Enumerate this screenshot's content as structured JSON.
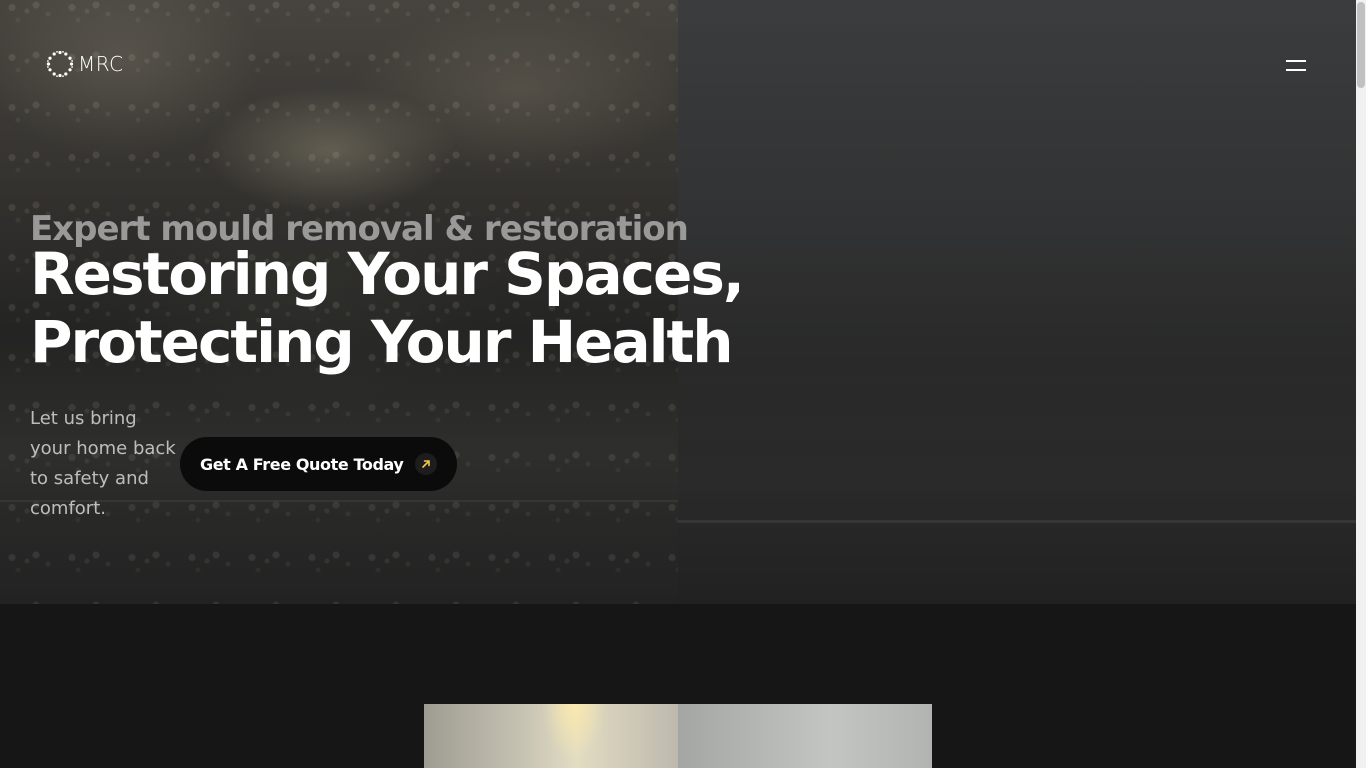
{
  "header": {
    "logo_text": "MRC",
    "logo_icon": "dotted-circle-icon",
    "menu_icon": "hamburger-menu-icon"
  },
  "hero": {
    "eyebrow": "Expert mould removal & restoration",
    "headline_line1": "Restoring Your Spaces,",
    "headline_line2": "Protecting Your Health",
    "subtext": "Let us bring your home back to safety and comfort.",
    "cta_label": "Get A Free Quote Today",
    "cta_icon": "arrow-up-right-icon"
  },
  "colors": {
    "page_background": "#161616",
    "cta_background": "#0b0b0b",
    "cta_arrow": "#f2c94c",
    "text_primary": "#ffffff"
  }
}
